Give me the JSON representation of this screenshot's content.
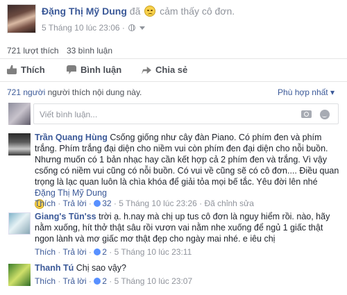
{
  "post": {
    "author_name": "Đặng Thị Mỹ Dung",
    "action_prefix": "đã",
    "feeling_text": "cảm thấy cô đơn.",
    "timestamp": "5 Tháng 10 lúc 23:06 ·",
    "feeling_icon": "sad-face-icon",
    "privacy_icon": "globe-icon"
  },
  "stats": {
    "likes": "721 lượt thích",
    "comments": "33 bình luận"
  },
  "actions": {
    "like": "Thích",
    "comment": "Bình luận",
    "share": "Chia sẻ"
  },
  "likes_summary": {
    "count": "721 người",
    "text": "người thích nội dung này."
  },
  "sort": {
    "label": "Phù hợp nhất ▾"
  },
  "compose": {
    "placeholder": "Viết bình luận..."
  },
  "comments": [
    {
      "name": "Trần Quang Hùng",
      "text": "Csống giống như cây đàn Piano. Có phím đen và phím trắng. Phím trắng đại diện cho niềm vui còn phím đen đại diện cho nỗi buồn. Nhưng muốn có 1 bản nhạc hay cần kết hợp cả 2 phím đen và trắng. Vì vậy csống có niềm vui cũng có nỗi buồn. Có vui về cũng sẽ có cô đơn.... Điều quan trọng là lạc quan luôn là chìa khóa để giải tỏa mọi bế tắc. Yêu đời lên nhé",
      "tag": "Đặng Thị Mỹ Dung",
      "like_label": "Thích",
      "reply_label": "Trả lời",
      "reactions": "32",
      "time": "5 Tháng 10 lúc 23:26",
      "edited": "Đã chỉnh sửa"
    },
    {
      "name": "Giang's Tũn'ss",
      "text": "trời ạ. h.nay mà chị up tus cô đơn là nguy hiểm rồi. nào, hãy nằm xuống, hít thở thật sâu rồi vươn vai nằm nhe xuống để ngủ 1 giấc thật ngon lành và mơ giấc mơ thật đẹp cho ngày mai nhé. e iêu chị",
      "like_label": "Thích",
      "reply_label": "Trả lời",
      "reactions": "2",
      "time": "5 Tháng 10 lúc 23:11"
    },
    {
      "name": "Thanh Tú",
      "text": "Chị sao vậy?",
      "like_label": "Thích",
      "reply_label": "Trả lời",
      "reactions": "2",
      "time": "5 Tháng 10 lúc 23:07"
    }
  ]
}
